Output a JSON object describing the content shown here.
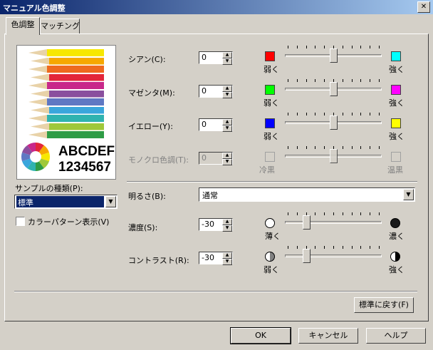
{
  "window": {
    "title": "マニュアル色調整",
    "close_glyph": "✕"
  },
  "tabs": [
    {
      "label": "色調整",
      "active": true
    },
    {
      "label": "マッチング",
      "active": false
    }
  ],
  "preview": {
    "text_line1": "ABCDEF",
    "text_line2": "1234567",
    "pencil_colors": [
      "#f7e800",
      "#f6a800",
      "#ee6a1f",
      "#e3263a",
      "#c8288a",
      "#8a4f9e",
      "#5f78c3",
      "#3aa6dc",
      "#2fb3b0",
      "#9fc83a",
      "#2e9c45"
    ]
  },
  "sample": {
    "label": "サンプルの種類(P):",
    "selected": "標準",
    "color_pattern_label": "カラーパターン表示(V)",
    "color_pattern_checked": false
  },
  "sliders": [
    {
      "label": "シアン(C):",
      "value": "0",
      "left_label": "弱く",
      "right_label": "強く",
      "left_color": "#ff0000",
      "right_color": "#00ffff",
      "level": 0.5,
      "enabled": true
    },
    {
      "label": "マゼンタ(M):",
      "value": "0",
      "left_label": "弱く",
      "right_label": "強く",
      "left_color": "#00ff00",
      "right_color": "#ff00ff",
      "level": 0.5,
      "enabled": true
    },
    {
      "label": "イエロー(Y):",
      "value": "0",
      "left_label": "弱く",
      "right_label": "強く",
      "left_color": "#0000ff",
      "right_color": "#ffff00",
      "level": 0.5,
      "enabled": true
    },
    {
      "label": "モノクロ色調(T):",
      "value": "0",
      "left_label": "冷黒",
      "right_label": "温黒",
      "left_color": "#d4d0c8",
      "right_color": "#d4d0c8",
      "level": 0.5,
      "enabled": false
    }
  ],
  "brightness": {
    "label": "明るさ(B):",
    "selected": "通常"
  },
  "density": {
    "label": "濃度(S):",
    "value": "-30",
    "left_label": "薄く",
    "right_label": "濃く",
    "level": 0.2
  },
  "contrast": {
    "label": "コントラスト(R):",
    "value": "-30",
    "left_label": "弱く",
    "right_label": "強く",
    "level": 0.2
  },
  "buttons": {
    "reset": "標準に戻す(F)",
    "ok": "OK",
    "cancel": "キャンセル",
    "help": "ヘルプ"
  },
  "icons": {
    "dropdown_arrow": "▼",
    "spin_up": "▲",
    "spin_down": "▼"
  }
}
